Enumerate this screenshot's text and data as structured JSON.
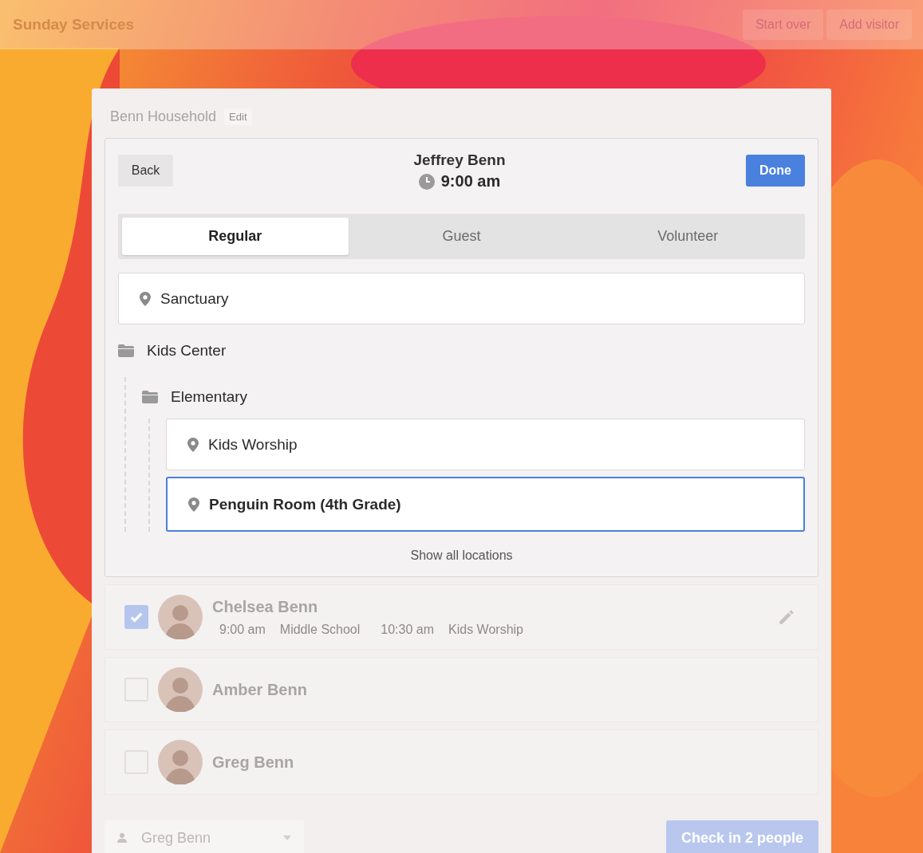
{
  "header": {
    "title": "Sunday Services",
    "buttons": [
      "Start over",
      "Add visitor"
    ]
  },
  "household": {
    "name": "Benn Household",
    "edit_label": "Edit"
  },
  "person_panel": {
    "back_label": "Back",
    "name": "Jeffrey Benn",
    "time": "9:00 am",
    "done_label": "Done",
    "tabs": [
      {
        "label": "Regular",
        "selected": true
      },
      {
        "label": "Guest",
        "selected": false
      },
      {
        "label": "Volunteer",
        "selected": false
      }
    ],
    "locations": [
      {
        "kind": "location",
        "label": "Sanctuary",
        "selected": false
      },
      {
        "kind": "folder",
        "label": "Kids Center",
        "children": [
          {
            "kind": "folder",
            "label": "Elementary",
            "children": [
              {
                "kind": "location",
                "label": "Kids Worship",
                "selected": false
              },
              {
                "kind": "location",
                "label": "Penguin Room (4th Grade)",
                "selected": true
              }
            ]
          }
        ]
      }
    ],
    "show_all_label": "Show all locations"
  },
  "people": [
    {
      "name": "Chelsea Benn",
      "checked": true,
      "editable": true,
      "details": [
        "9:00 am",
        "Middle School",
        "10:30 am",
        "Kids Worship"
      ]
    },
    {
      "name": "Amber Benn",
      "checked": false,
      "editable": false
    },
    {
      "name": "Greg Benn",
      "checked": false,
      "editable": false
    }
  ],
  "footer": {
    "selected_person": "Greg Benn",
    "checkin_label": "Check in 2 people"
  }
}
